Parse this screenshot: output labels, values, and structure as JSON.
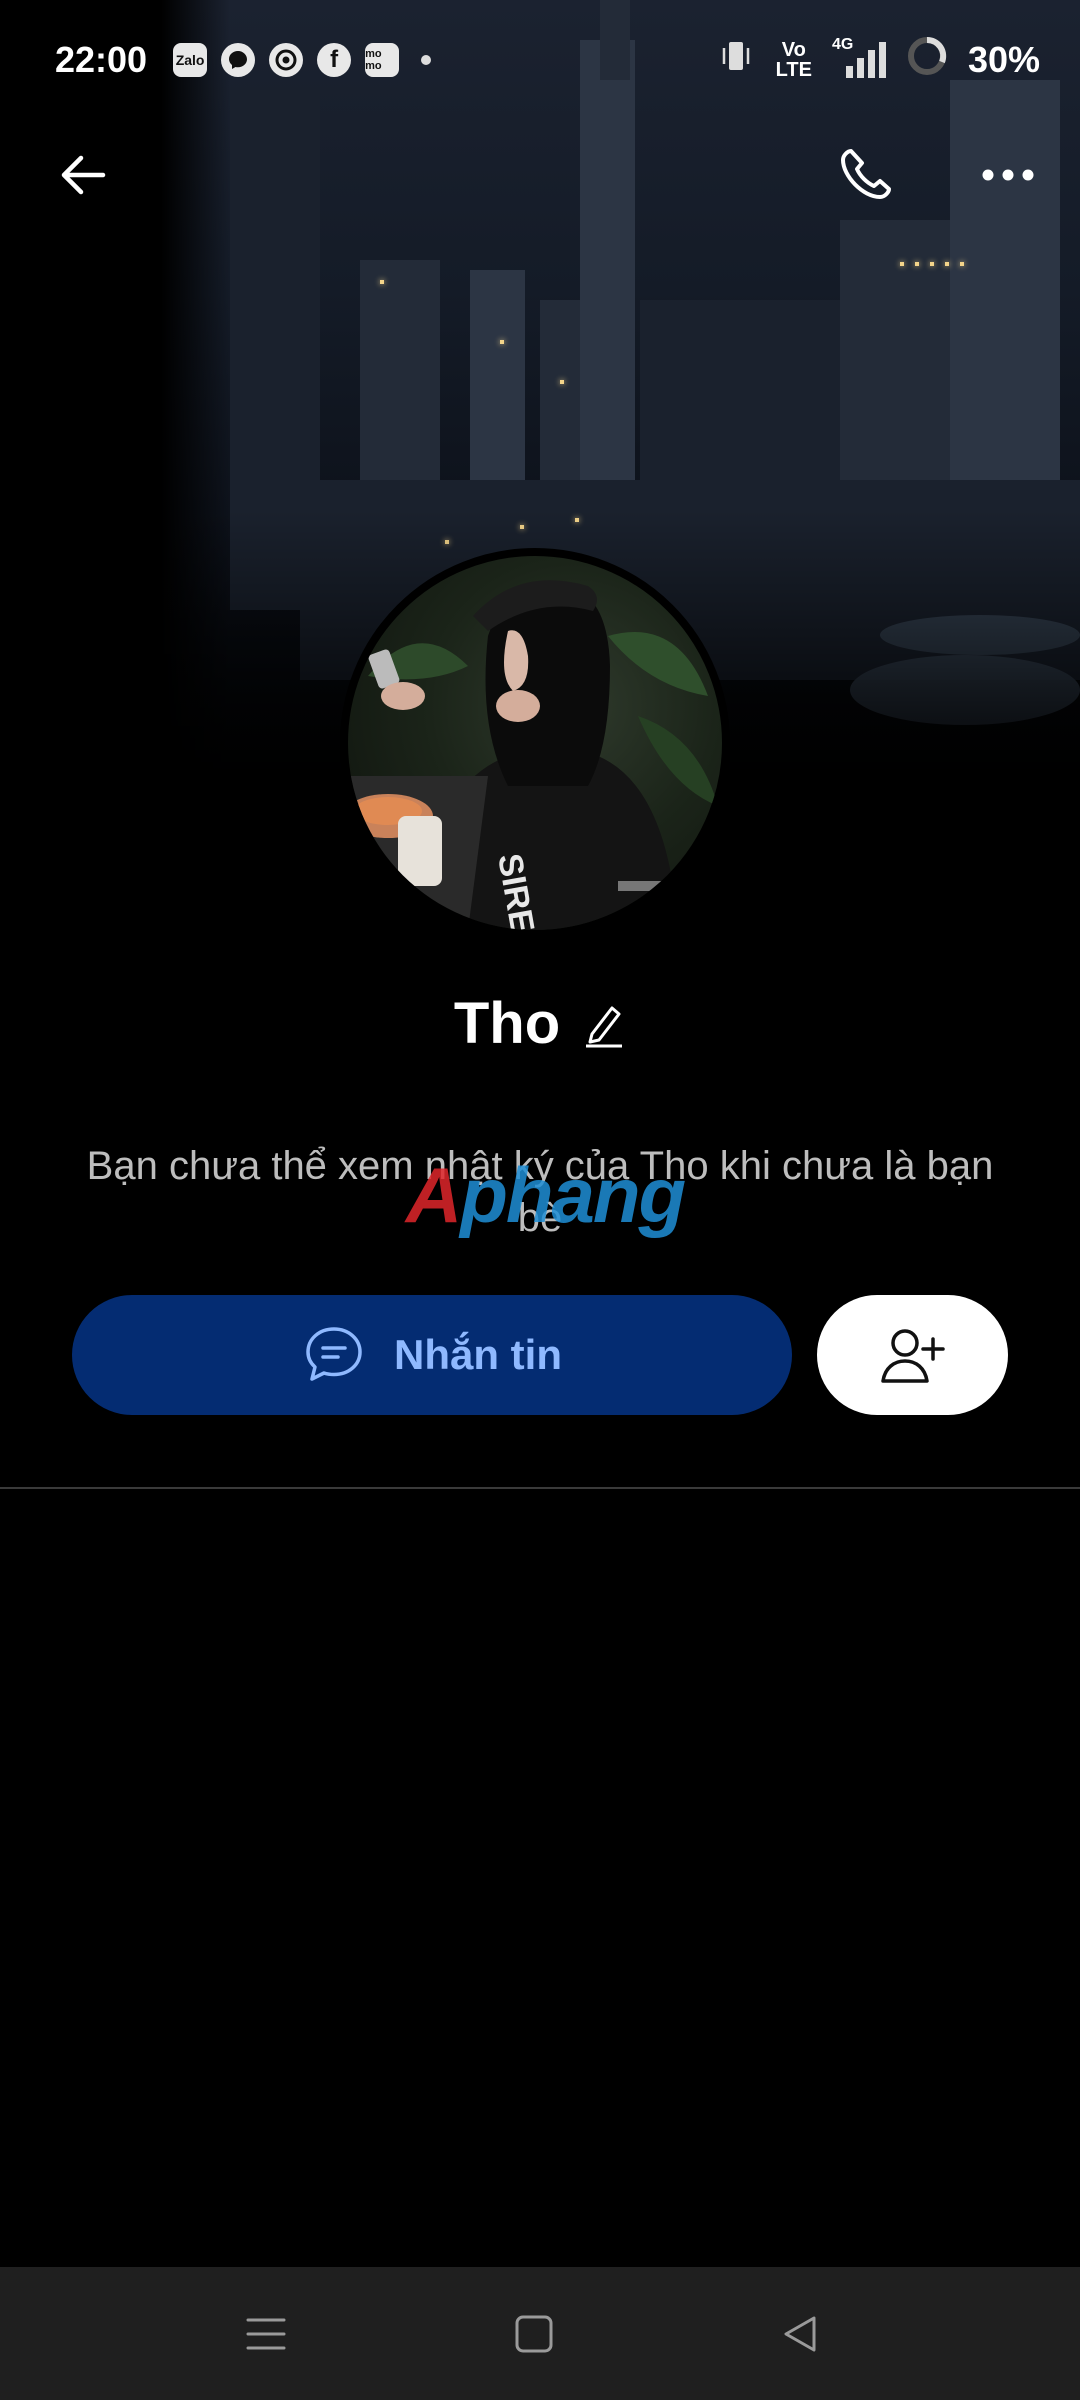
{
  "status_bar": {
    "time": "22:00",
    "app_icons": [
      "zalo-icon",
      "messenger-icon",
      "chrome-icon",
      "facebook-icon",
      "momo-icon"
    ],
    "zalo_label": "Zalo",
    "momo_label": "mo mo",
    "volte_top": "Vo",
    "volte_bottom": "LTE",
    "network": "4G",
    "battery": "30%"
  },
  "profile": {
    "name": "Tho",
    "privacy_notice": "Bạn chưa thể xem nhật ký của Tho khi chưa là bạn bè",
    "message_button_label": "Nhắn tin"
  },
  "watermark": {
    "text_red": "A",
    "text_blue": "phang"
  },
  "colors": {
    "message_button_bg": "#042c72",
    "message_button_text": "#8fb9ff",
    "background": "#000000"
  }
}
